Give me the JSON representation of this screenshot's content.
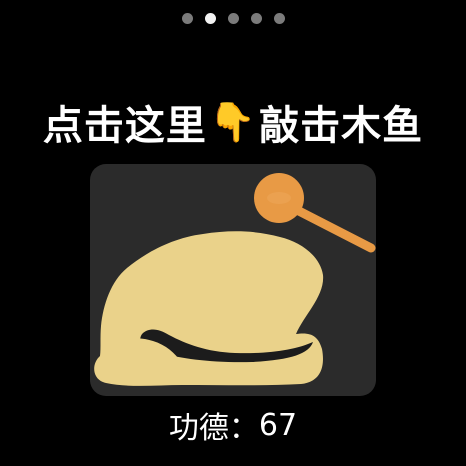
{
  "pager": {
    "dots": [
      {
        "active": false
      },
      {
        "active": true
      },
      {
        "active": false
      },
      {
        "active": false
      },
      {
        "active": false
      }
    ]
  },
  "headline": {
    "prefix": "点击这里",
    "emoji": "👇",
    "suffix": "敲击木鱼"
  },
  "merit": {
    "label": "功德：",
    "value": "67"
  },
  "colors": {
    "background": "#000000",
    "card": "#2b2b2b",
    "fish": "#ead28a",
    "mallet": "#e89a45",
    "dot_active": "#f2f2f2",
    "dot_inactive": "#7b7b7b"
  }
}
